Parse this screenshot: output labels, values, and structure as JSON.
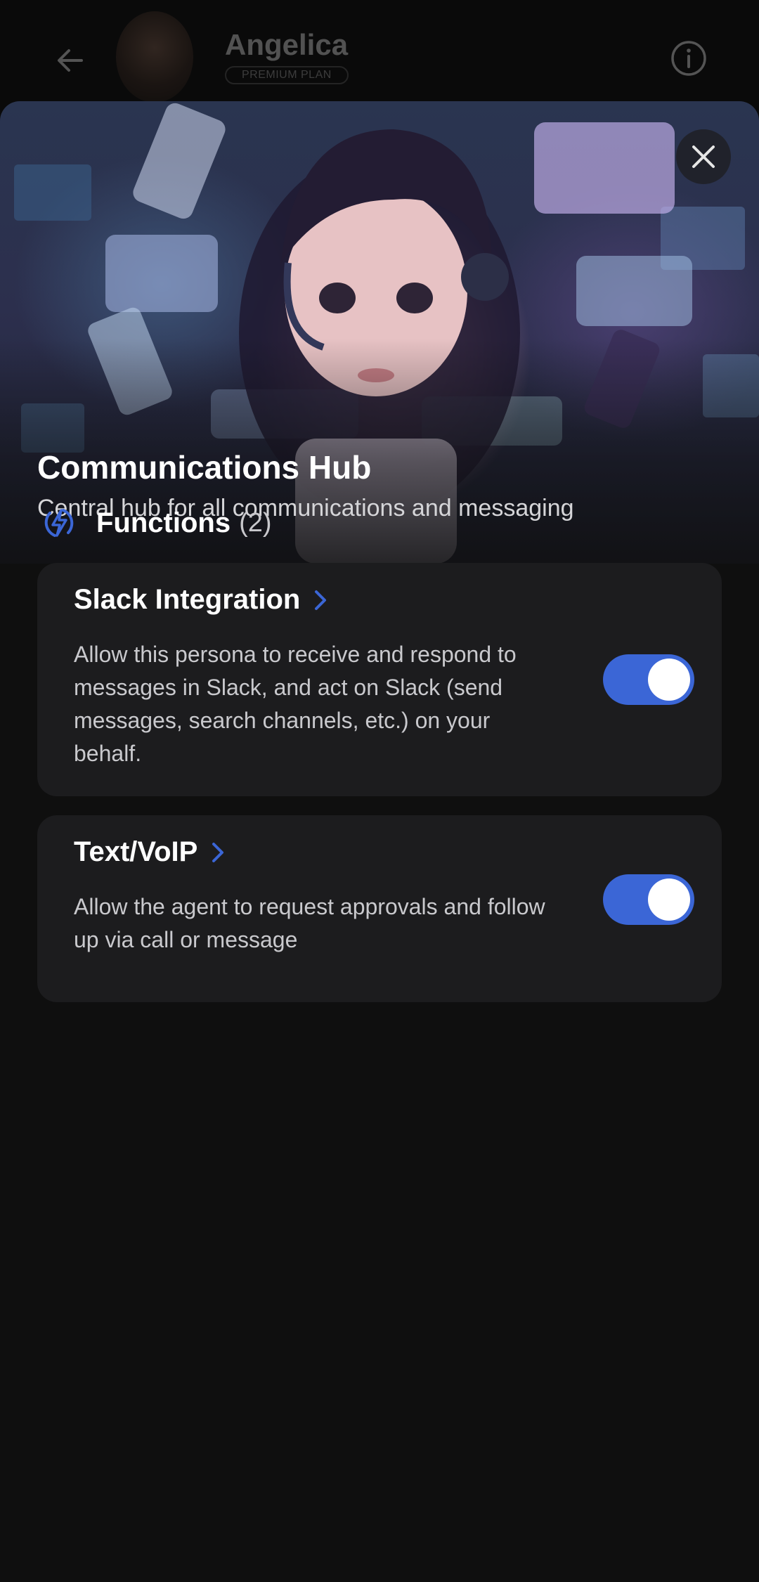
{
  "header": {
    "persona_name": "Angelica",
    "plan_badge": "PREMIUM PLAN",
    "back_icon": "arrow-left-icon",
    "info_icon": "info-icon"
  },
  "hero": {
    "title": "Communications Hub",
    "subtitle": "Central hub for all communications and messaging",
    "close_icon": "close-icon"
  },
  "functions": {
    "title": "Functions",
    "count": "(2)",
    "icon": "lightning-bolt-icon",
    "items": [
      {
        "title": "Slack Integration",
        "description": "Allow this persona to receive and respond to messages in Slack, and act on Slack (send messages, search channels, etc.) on your behalf.",
        "enabled": true
      },
      {
        "title": "Text/VoIP",
        "description": "Allow the agent to request approvals and follow up via call or message",
        "enabled": true
      }
    ]
  },
  "colors": {
    "accent": "#3b66d6",
    "background": "#0f0f0f",
    "card": "#1c1c1e"
  }
}
